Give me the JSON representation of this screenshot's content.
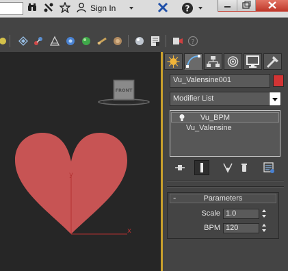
{
  "titlebar": {
    "signin_label": "Sign In",
    "window_controls": [
      "minimize",
      "restore",
      "close"
    ]
  },
  "main_toolbar": {
    "icons": [
      "layer-icon",
      "link-icon",
      "unlink-icon",
      "bind-space-warp-icon",
      "selection-filter-icon",
      "curve-editor-icon",
      "schematic-view-icon",
      "material-editor-icon",
      "render-setup-icon",
      "rendered-frame-icon",
      "render-icon",
      "help-icon"
    ]
  },
  "viewport": {
    "gizmo_label": "FRONT",
    "axis_y": "y",
    "axis_x": "x",
    "heart_color": "#c75454"
  },
  "command_panel": {
    "tabs": [
      "create",
      "modify",
      "hierarchy",
      "motion",
      "display",
      "utilities"
    ],
    "active_tab": "modify",
    "object_name": "Vu_Valensine001",
    "object_color": "#d33434",
    "modifier_list": "Modifier List",
    "stack": [
      {
        "label": "Vu_BPM",
        "type": "modifier"
      },
      {
        "label": "Vu_Valensine",
        "type": "base"
      }
    ],
    "parameters": {
      "title": "Parameters",
      "collapse": "-",
      "scale_label": "Scale",
      "scale_value": "1.0",
      "bpm_label": "BPM",
      "bpm_value": "120"
    }
  }
}
